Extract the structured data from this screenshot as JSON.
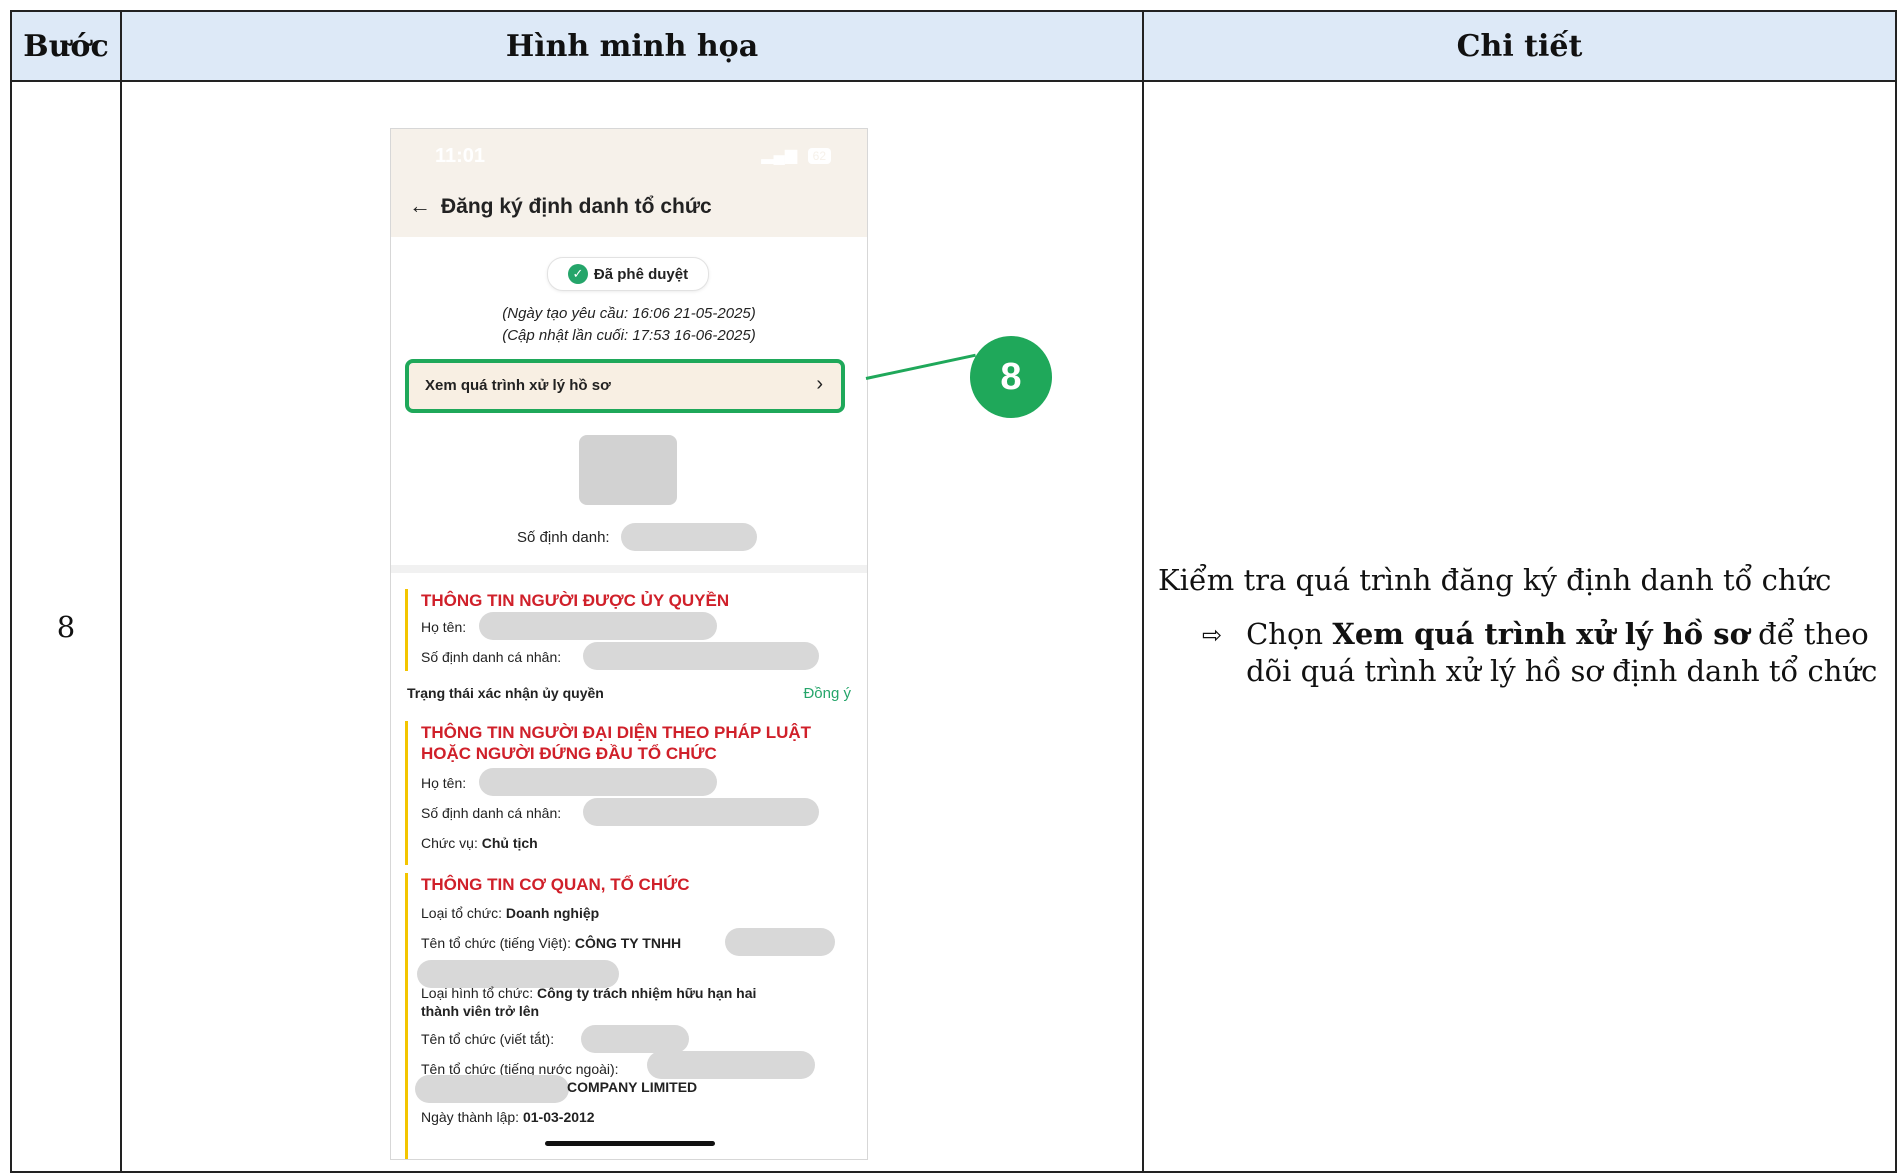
{
  "table": {
    "headers": [
      "Bước",
      "Hình minh họa",
      "Chi tiết"
    ],
    "step": "8",
    "detail": {
      "main": "Kiểm tra quá trình đăng ký định danh tổ chức",
      "bullet_prefix": "Chọn ",
      "bullet_bold": "Xem quá trình xử lý hồ sơ",
      "bullet_suffix": " để theo dõi quá trình xử lý hồ sơ định danh tổ chức",
      "bullet_icon": "right-arrow-icon"
    }
  },
  "callout": {
    "number": "8",
    "color": "#1fa85a"
  },
  "phone": {
    "status_time": "11:01",
    "battery": "62",
    "title": "Đăng ký định danh tổ chức",
    "status_badge": "Đã phê duyệt",
    "created_line": "(Ngày tạo yêu cầu: 16:06 21-05-2025)",
    "updated_line": "(Cập nhật lần cuối: 17:53 16-06-2025)",
    "process_button": "Xem quá trình xử lý hồ sơ",
    "id_label": "Số định danh:",
    "section1": {
      "title": "THÔNG TIN NGƯỜI ĐƯỢC ỦY QUYỀN",
      "name_label": "Họ tên:",
      "personal_id_label": "Số định danh cá nhân:"
    },
    "auth_status_label": "Trạng thái xác nhận ủy quyền",
    "auth_status_value": "Đồng ý",
    "section2": {
      "title_line1": "THÔNG TIN NGƯỜI ĐẠI DIỆN THEO PHÁP LUẬT",
      "title_line2": "HOẶC NGƯỜI ĐỨNG ĐẦU TỔ CHỨC",
      "name_label": "Họ tên:",
      "personal_id_label": "Số định danh cá nhân:",
      "position_label": "Chức vụ: ",
      "position_value": "Chủ tịch"
    },
    "section3": {
      "title": "THÔNG TIN CƠ QUAN, TỔ CHỨC",
      "org_type_label": "Loại tổ chức: ",
      "org_type_value": "Doanh nghiệp",
      "name_vi_label": "Tên tổ chức (tiếng Việt): ",
      "name_vi_value": "CÔNG TY TNHH",
      "form_label": "Loại hình tổ chức: ",
      "form_value_line1": "Công ty trách nhiệm hữu hạn hai",
      "form_value_line2": "thành viên trở lên",
      "short_name_label": "Tên tổ chức (viết tắt):",
      "foreign_name_label": "Tên tổ chức (tiếng nước ngoài):",
      "foreign_name_value": "COMPANY LIMITED",
      "founded_label": "Ngày thành lập: ",
      "founded_value": "01-03-2012"
    }
  }
}
